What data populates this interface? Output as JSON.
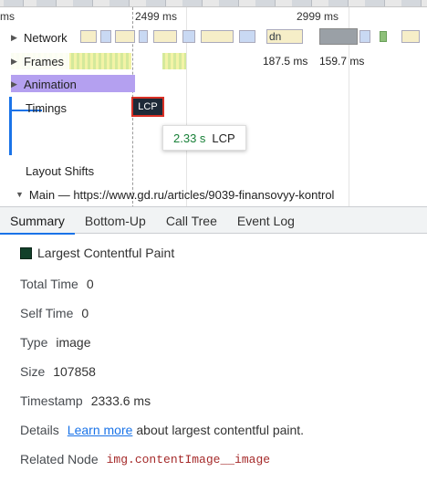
{
  "timeline": {
    "ruler_ticks": [
      "ms",
      "2499 ms",
      "2999 ms"
    ],
    "tracks": {
      "network": "Network",
      "frames": "Frames",
      "animation": "Animation",
      "timings": "Timings",
      "layout_shifts": "Layout Shifts"
    },
    "network_chip_label": "dn",
    "frame_durations": [
      "187.5 ms",
      "159.7 ms"
    ],
    "lcp_marker": "LCP",
    "tooltip": {
      "time": "2.33 s",
      "label": "LCP"
    },
    "main_thread": "Main — https://www.gd.ru/articles/9039-finansovyy-kontrol"
  },
  "tabs": [
    "Summary",
    "Bottom-Up",
    "Call Tree",
    "Event Log"
  ],
  "details": {
    "title": "Largest Contentful Paint",
    "swatch_color": "#12402a",
    "rows": {
      "total_time": {
        "key": "Total Time",
        "value": "0"
      },
      "self_time": {
        "key": "Self Time",
        "value": "0"
      },
      "type": {
        "key": "Type",
        "value": "image"
      },
      "size": {
        "key": "Size",
        "value": "107858"
      },
      "timestamp": {
        "key": "Timestamp",
        "value": "2333.6 ms"
      },
      "details": {
        "key": "Details",
        "link": "Learn more",
        "text": "about largest contentful paint."
      },
      "related_node": {
        "key": "Related Node",
        "value": "img.contentImage__image"
      }
    }
  }
}
